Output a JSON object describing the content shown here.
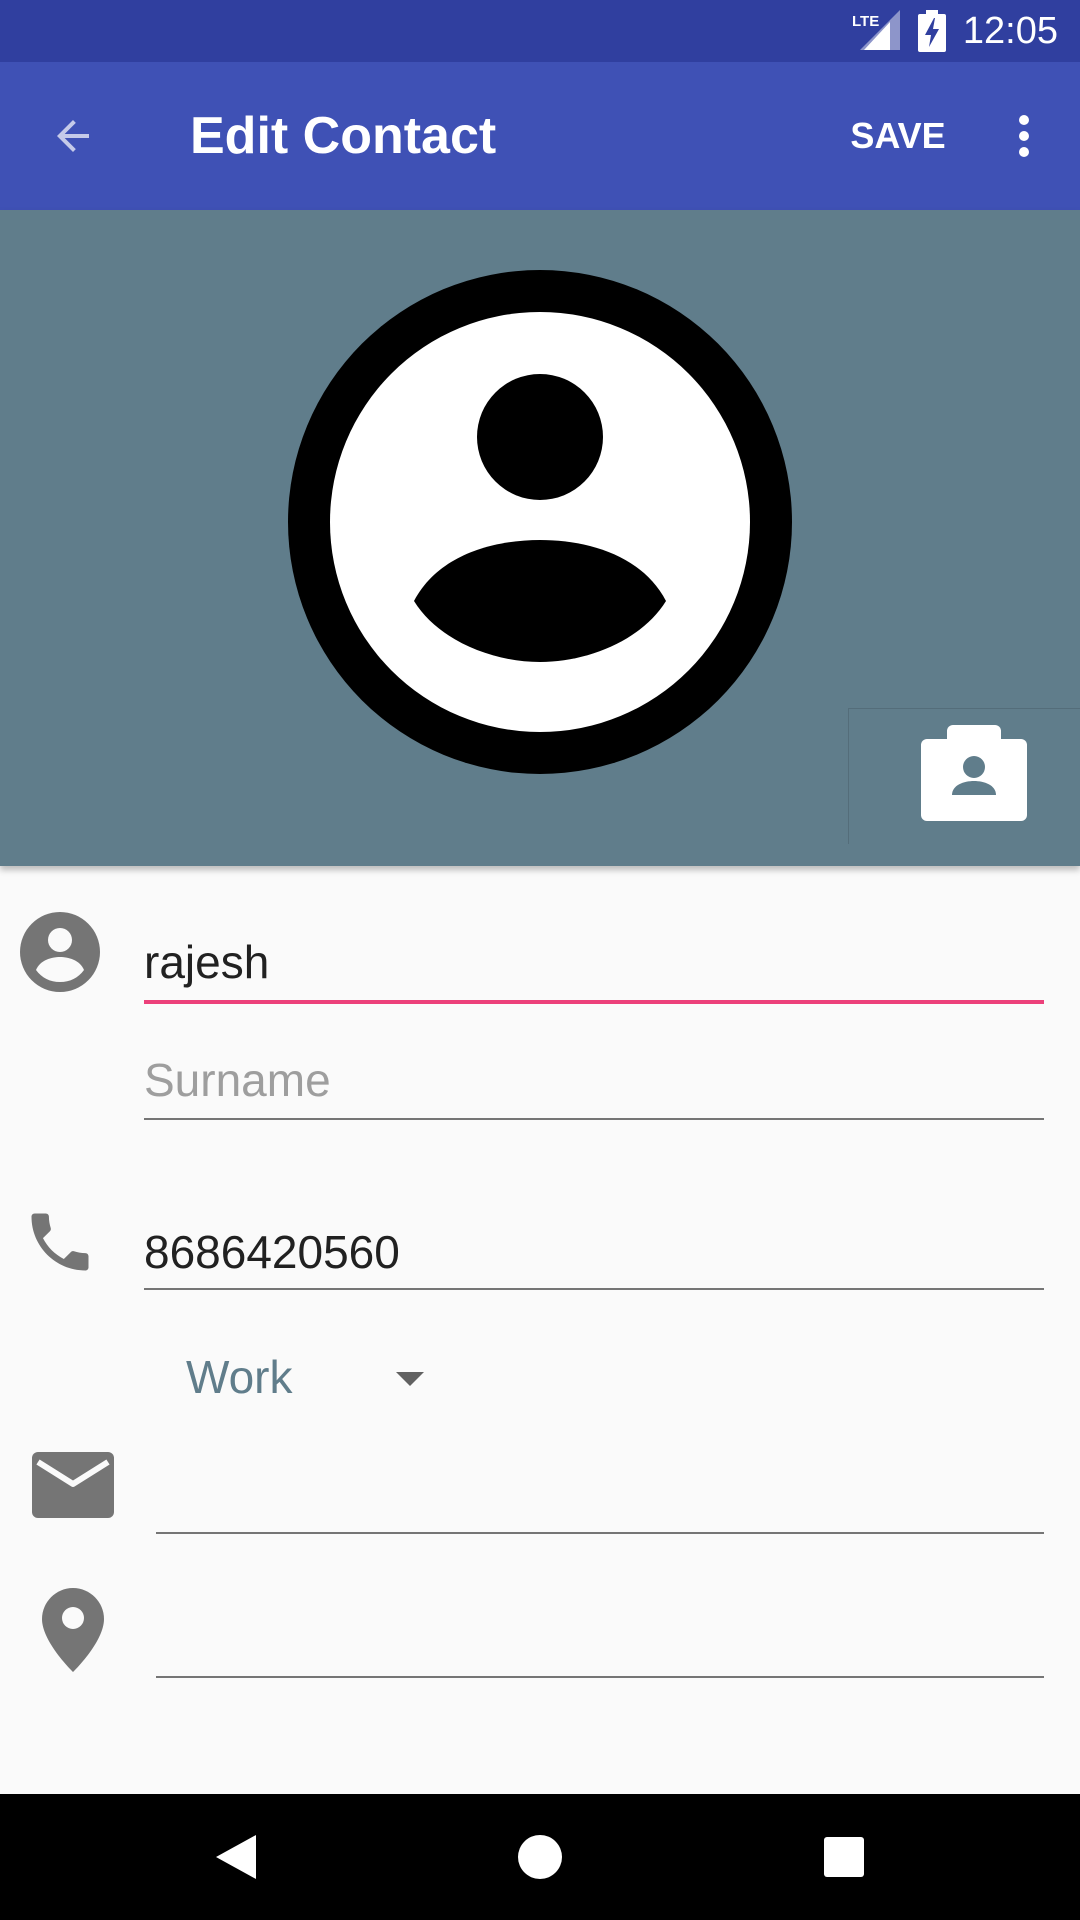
{
  "status_bar": {
    "time": "12:05",
    "network_label": "LTE",
    "icons": [
      "lte-signal-icon",
      "battery-charging-icon"
    ],
    "background_color": "#303f9f"
  },
  "app_bar": {
    "title": "Edit Contact",
    "save_label": "SAVE",
    "back_icon": "arrow-back-icon",
    "overflow_icon": "more-vert-icon",
    "background_color": "#3f51b5"
  },
  "photo": {
    "background_color": "#607d8b",
    "avatar_icon": "account-circle-icon",
    "change_photo_icon": "camera-contact-icon"
  },
  "form": {
    "first_name": {
      "value": "rajesh",
      "placeholder": ""
    },
    "surname": {
      "value": "",
      "placeholder": "Surname"
    },
    "phone": {
      "value": "8686420560",
      "placeholder": ""
    },
    "phone_type": "Work",
    "email": {
      "value": "",
      "placeholder": ""
    },
    "address": {
      "value": "",
      "placeholder": ""
    },
    "accent_color": "#ec407a"
  },
  "nav_bar": {
    "icons": [
      "nav-back-icon",
      "nav-home-icon",
      "nav-recents-icon"
    ]
  }
}
